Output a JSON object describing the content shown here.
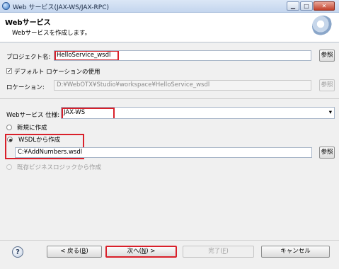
{
  "window": {
    "title": "Web サービス(JAX-WS/JAX-RPC)",
    "minimize_glyph": "▁",
    "maximize_glyph": "□",
    "close_glyph": "✕"
  },
  "header": {
    "title": "Webサービス",
    "subtitle": "Webサービスを作成します。",
    "icon": "web-service-wizard-icon"
  },
  "project": {
    "label": "プロジェクト名:",
    "value": "HelloService_wsdl",
    "browse_label": "参照"
  },
  "default_location": {
    "label": "デフォルト ロケーションの使用",
    "checked": true
  },
  "location": {
    "label": "ロケーション:",
    "value": "D:¥WebOTX¥Studio¥workspace¥HelloService_wsdl",
    "browse_label": "参照"
  },
  "spec": {
    "label": "Webサービス 仕様:",
    "value": "JAX-WS",
    "dropdown_glyph": "▾"
  },
  "options": {
    "new_label": "新規に作成",
    "wsdl_label": "WSDLから作成",
    "wsdl_path": "C:¥AddNumbers.wsdl",
    "wsdl_browse_label": "参照",
    "existing_label": "既存ビジネスロジックから作成",
    "selected": "wsdl"
  },
  "footer": {
    "help_glyph": "?",
    "back_text": "< 戻る(",
    "back_mnemonic": "B",
    "back_close": ")",
    "next_text": "次へ(",
    "next_mnemonic": "N",
    "next_close": ") >",
    "finish_text": "完了(",
    "finish_mnemonic": "F",
    "finish_close": ")",
    "cancel_label": "キャンセル"
  },
  "colors": {
    "highlight": "#d9202a",
    "title_bar": "#c4d6ee",
    "dialog_bg": "#f0f0f0"
  }
}
